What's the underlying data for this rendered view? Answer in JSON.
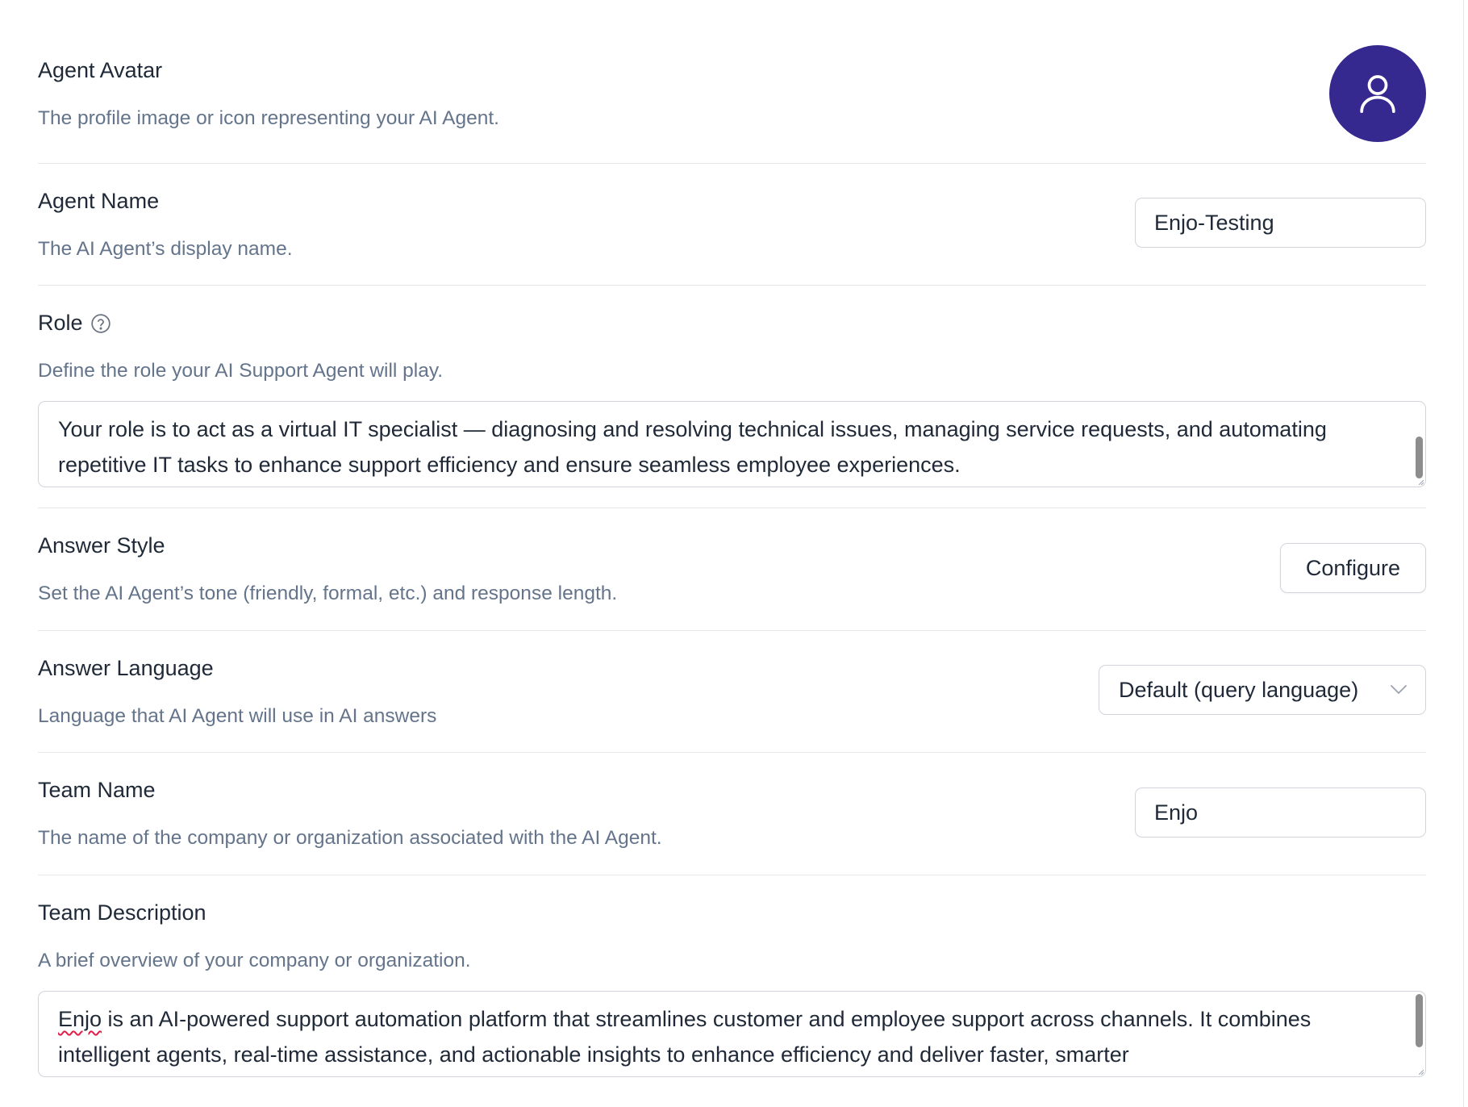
{
  "agent_avatar": {
    "label": "Agent Avatar",
    "description": "The profile image or icon representing your AI Agent.",
    "icon": "user-icon",
    "background_color": "#35288f"
  },
  "agent_name": {
    "label": "Agent Name",
    "description": "The AI Agent’s display name.",
    "value": "Enjo-Testing"
  },
  "role": {
    "label": "Role",
    "help_icon": "question-circle-icon",
    "description": "Define the role your AI Support Agent will play.",
    "value": "Your role is to act as a virtual IT specialist — diagnosing and resolving technical issues, managing service requests, and automating repetitive IT tasks to enhance support efficiency and ensure seamless employee experiences."
  },
  "answer_style": {
    "label": "Answer Style",
    "description": "Set the AI Agent’s tone (friendly, formal, etc.) and response length.",
    "button_label": "Configure"
  },
  "answer_language": {
    "label": "Answer Language",
    "description": "Language that AI Agent will use in AI answers",
    "selected": "Default (query language)"
  },
  "team_name": {
    "label": "Team Name",
    "description": "The name of the company or organization associated with the AI Agent.",
    "value": "Enjo"
  },
  "team_description": {
    "label": "Team Description",
    "description": "A brief overview of your company or organization.",
    "value_first_word": "Enjo",
    "value_rest": " is an AI-powered support automation platform that streamlines customer and employee support across channels. It combines intelligent agents, real-time assistance, and actionable insights to enhance efficiency and deliver faster, smarter"
  }
}
